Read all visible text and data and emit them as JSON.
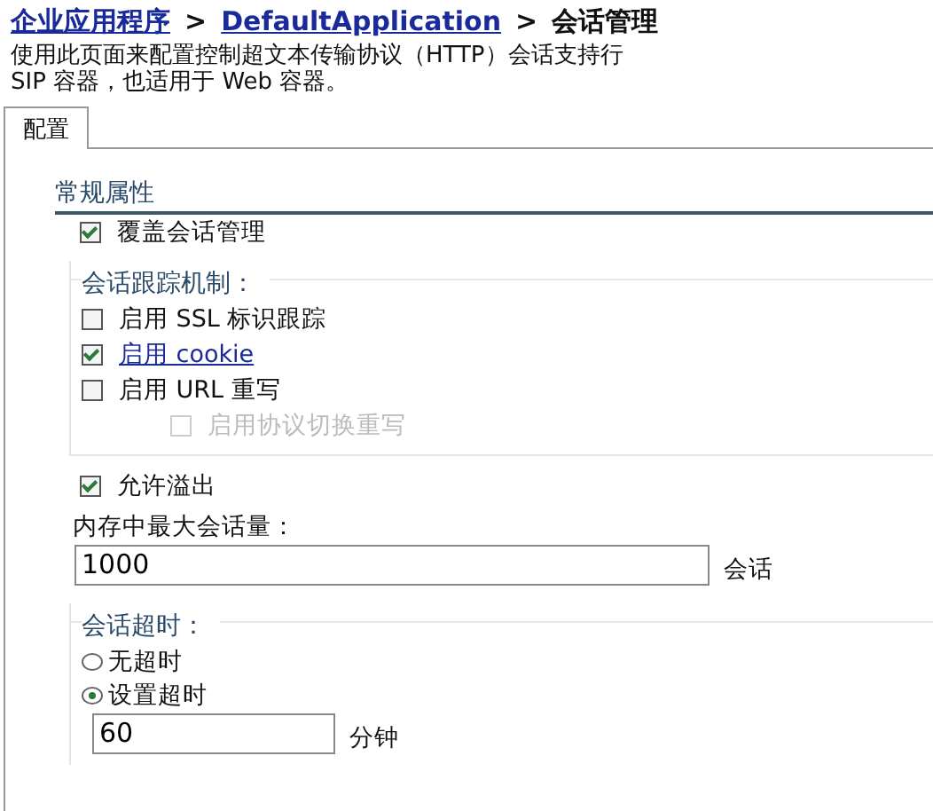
{
  "breadcrumb": {
    "separator": ">",
    "items": [
      {
        "label": "企业应用程序",
        "link": true
      },
      {
        "label": "DefaultApplication",
        "link": true
      },
      {
        "label": "会话管理",
        "link": false
      }
    ]
  },
  "description": [
    "使用此页面来配置控制超文本传输协议（HTTP）会话支持行",
    "SIP 容器，也适用于 Web 容器。"
  ],
  "tabs": [
    {
      "label": "配置",
      "selected": true
    }
  ],
  "section_title": "常规属性",
  "override": {
    "label": "覆盖会话管理",
    "checked": true
  },
  "tracking": {
    "legend": "会话跟踪机制：",
    "options": [
      {
        "label": "启用 SSL 标识跟踪",
        "checked": false,
        "disabled": false,
        "link": false
      },
      {
        "label": "启用 cookie",
        "checked": true,
        "disabled": false,
        "link": true
      },
      {
        "label": "启用 URL 重写",
        "checked": false,
        "disabled": false,
        "link": false,
        "children": [
          {
            "label": "启用协议切换重写",
            "checked": false,
            "disabled": true,
            "link": false
          }
        ]
      }
    ]
  },
  "overflow": {
    "label": "允许溢出",
    "checked": true
  },
  "max_sessions": {
    "label": "内存中最大会话量：",
    "value": "1000",
    "unit": "会话"
  },
  "timeout": {
    "legend": "会话超时：",
    "options": [
      {
        "label": "无超时",
        "selected": false
      },
      {
        "label": "设置超时",
        "selected": true
      }
    ],
    "value": "60",
    "unit": "分钟"
  }
}
